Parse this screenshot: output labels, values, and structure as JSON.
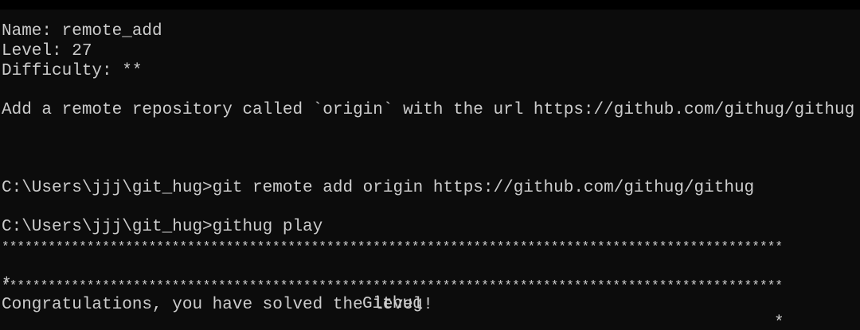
{
  "colors": {
    "background": "#0c0c0c",
    "text": "#cccccc"
  },
  "terminal": {
    "lines": {
      "name": "Name: remote_add",
      "level": "Level: 27",
      "difficulty": "Difficulty: **",
      "description": "Add a remote repository called `origin` with the url https://github.com/githug/githug",
      "command1": "C:\\Users\\jjj\\git_hug>git remote add origin https://github.com/githug/githug",
      "command2": "C:\\Users\\jjj\\git_hug>githug play",
      "stars_top": "*****************************************************************************************************",
      "banner_left": "*",
      "banner_title": "Githug",
      "banner_right": "*",
      "stars_bottom": "*****************************************************************************************************",
      "result": "Congratulations, you have solved the level!"
    }
  }
}
